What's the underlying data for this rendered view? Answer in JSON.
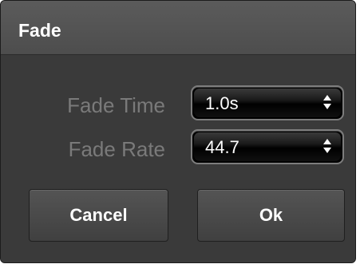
{
  "dialog": {
    "title": "Fade"
  },
  "fields": {
    "fade_time": {
      "label": "Fade Time",
      "value": "1.0s"
    },
    "fade_rate": {
      "label": "Fade Rate",
      "value": "44.7"
    }
  },
  "buttons": {
    "cancel_label": "Cancel",
    "ok_label": "Ok"
  },
  "icons": {
    "select_arrows": "up-down-chevron-icon"
  },
  "colors": {
    "dialog_background": "#3a3a3a",
    "titlebar": "#555555",
    "label_text": "#7a7a7a",
    "select_background": "#000000",
    "button_background": "#4a4a4a",
    "button_text": "#ffffff"
  }
}
